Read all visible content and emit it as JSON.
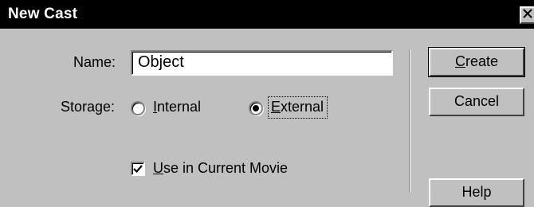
{
  "window": {
    "title": "New Cast",
    "close_glyph": "✕"
  },
  "form": {
    "name_label": "Name:",
    "name_value": "Object",
    "storage_label": "Storage:",
    "storage_options": [
      {
        "label": "Internal",
        "selected": false
      },
      {
        "label": "External",
        "selected": true
      }
    ],
    "use_in_movie_label": "Use in Current Movie",
    "use_in_movie_checked": true
  },
  "buttons": {
    "create": "Create",
    "cancel": "Cancel",
    "help": "Help"
  }
}
